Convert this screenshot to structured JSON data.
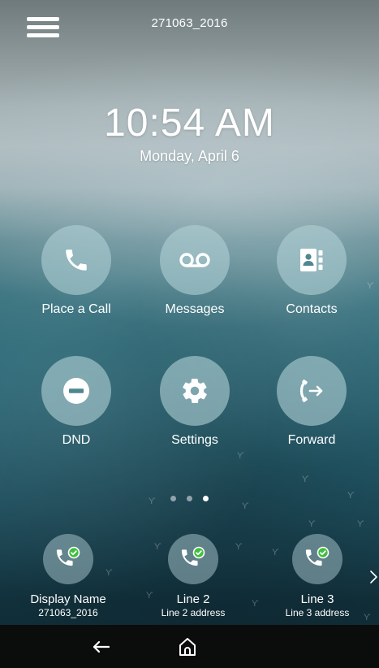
{
  "header": {
    "account": "271063_2016"
  },
  "clock": {
    "time": "10:54 AM",
    "date": "Monday, April 6"
  },
  "apps": [
    {
      "label": "Place a Call",
      "icon": "phone-icon"
    },
    {
      "label": "Messages",
      "icon": "voicemail-icon"
    },
    {
      "label": "Contacts",
      "icon": "contacts-icon"
    },
    {
      "label": "DND",
      "icon": "dnd-icon"
    },
    {
      "label": "Settings",
      "icon": "gear-icon"
    },
    {
      "label": "Forward",
      "icon": "forward-call-icon"
    }
  ],
  "pager": {
    "pages": 3,
    "active": 3
  },
  "lines": [
    {
      "name": "Display Name",
      "address": "271063_2016",
      "status": "registered"
    },
    {
      "name": "Line 2",
      "address": "Line 2 address",
      "status": "registered"
    },
    {
      "name": "Line 3",
      "address": "Line 3 address",
      "status": "registered"
    }
  ],
  "nav": {
    "back_icon": "back-arrow-icon",
    "home_icon": "home-icon"
  },
  "colors": {
    "status_green": "#3fbf3f",
    "icon_dark": "#2a6572"
  }
}
